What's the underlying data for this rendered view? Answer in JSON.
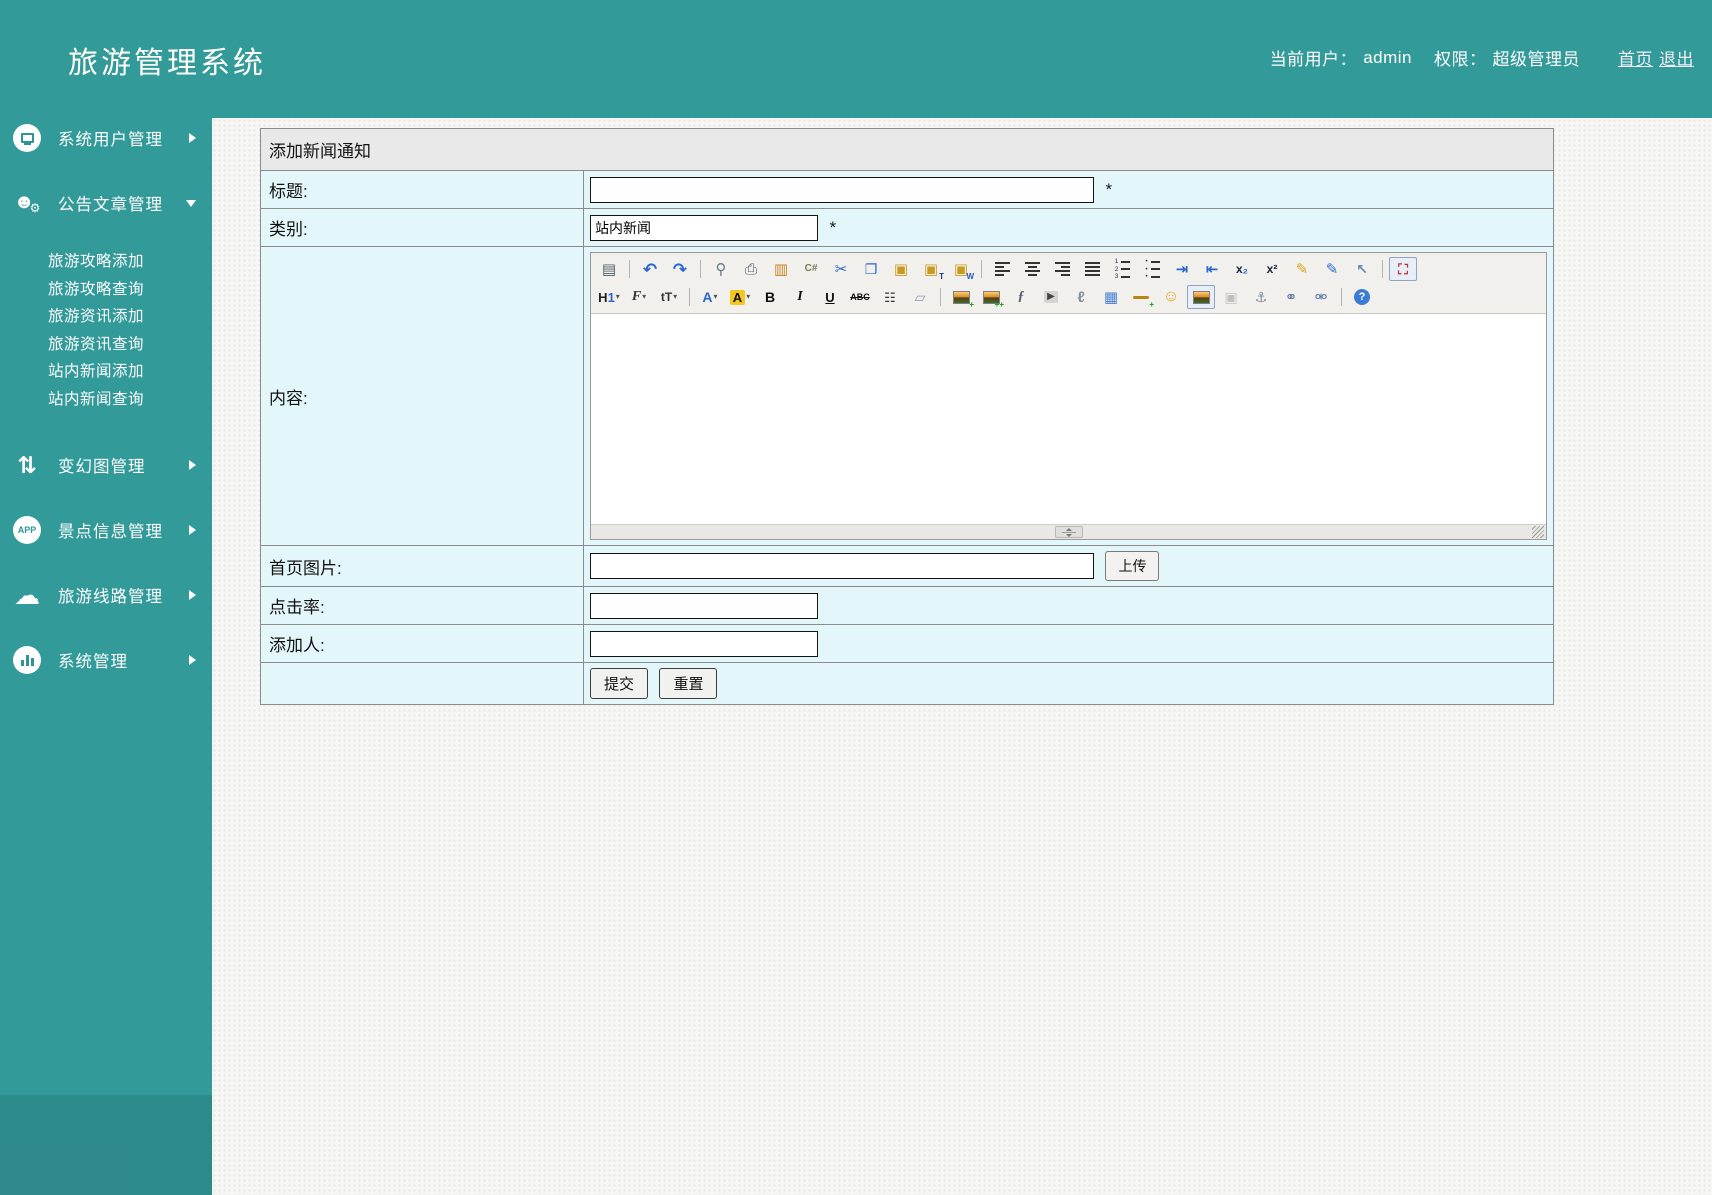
{
  "header": {
    "title": "旅游管理系统",
    "current_user_label": "当前用户：",
    "username": "admin",
    "role_label": "权限：",
    "role": "超级管理员",
    "nav_links": [
      {
        "id": "home",
        "label": "首页"
      },
      {
        "id": "logout",
        "label": "退出"
      }
    ],
    "accent_color": "#339a9a"
  },
  "sidebar": {
    "items": [
      {
        "id": "system-user-management",
        "label": "系统用户管理",
        "icon": "monitor-icon",
        "state": "collapsed"
      },
      {
        "id": "announcement-article-management",
        "label": "公告文章管理",
        "icon": "user-gear-icon",
        "state": "expanded",
        "submenu": [
          {
            "id": "travel-guide-add",
            "label": "旅游攻略添加"
          },
          {
            "id": "travel-guide-query",
            "label": "旅游攻略查询"
          },
          {
            "id": "travel-info-add",
            "label": "旅游资讯添加"
          },
          {
            "id": "travel-info-query",
            "label": "旅游资讯查询"
          },
          {
            "id": "site-news-add",
            "label": "站内新闻添加"
          },
          {
            "id": "site-news-query",
            "label": "站内新闻查询"
          }
        ]
      },
      {
        "id": "banner-image-management",
        "label": "变幻图管理",
        "icon": "swap-arrows-icon",
        "state": "collapsed"
      },
      {
        "id": "scenic-spot-management",
        "label": "景点信息管理",
        "icon": "app-circle-icon",
        "state": "collapsed"
      },
      {
        "id": "travel-route-management",
        "label": "旅游线路管理",
        "icon": "cloud-icon",
        "state": "collapsed"
      },
      {
        "id": "system-management",
        "label": "系统管理",
        "icon": "bar-chart-icon",
        "state": "collapsed"
      }
    ]
  },
  "form": {
    "title": "添加新闻通知",
    "fields": {
      "title": {
        "label": "标题:",
        "value": "",
        "required": "*"
      },
      "category": {
        "label": "类别:",
        "value": "站内新闻",
        "required": "*"
      },
      "content": {
        "label": "内容:",
        "value": ""
      },
      "image": {
        "label": "首页图片:",
        "value": "",
        "upload_button": "上传"
      },
      "clicks": {
        "label": "点击率:",
        "value": ""
      },
      "author": {
        "label": "添加人:",
        "value": ""
      }
    },
    "submit_button": "提交",
    "reset_button": "重置"
  },
  "editor": {
    "toolbar_row1": [
      {
        "name": "view-source-icon",
        "g": "▤",
        "c": "#4a5a66",
        "size": 15
      },
      {
        "sep": true
      },
      {
        "name": "undo-icon",
        "g": "↶",
        "c": "#2a66cc",
        "size": 17,
        "bold": true
      },
      {
        "name": "redo-icon",
        "g": "↷",
        "c": "#2a66cc",
        "size": 17,
        "bold": true
      },
      {
        "sep": true
      },
      {
        "name": "print-preview-icon",
        "g": "⚲",
        "c": "#667788",
        "size": 15,
        "bold": true
      },
      {
        "name": "print-icon",
        "g": "⎙",
        "c": "#556070",
        "size": 15
      },
      {
        "name": "page-properties-icon",
        "g": "▥",
        "c": "#c9821f",
        "size": 15
      },
      {
        "name": "insert-code-icon",
        "g": "C#",
        "c": "#7a7a52",
        "size": 10,
        "bold": true
      },
      {
        "name": "cut-icon",
        "g": "✂",
        "c": "#2a66cc",
        "size": 15
      },
      {
        "name": "copy-icon",
        "g": "❐",
        "c": "#2a66cc",
        "size": 14,
        "bold": true
      },
      {
        "name": "paste-icon",
        "g": "▣",
        "c": "#c99a1e",
        "size": 15
      },
      {
        "name": "paste-as-text-icon",
        "g": "▣",
        "c": "#c99a1e",
        "size": 15,
        "sub": "T",
        "subColor": "#223a8c"
      },
      {
        "name": "paste-from-word-icon",
        "g": "▣",
        "c": "#c99a1e",
        "size": 15,
        "sub": "W",
        "subColor": "#2255cc"
      },
      {
        "sep": true
      },
      {
        "name": "align-left-icon",
        "bars": "left"
      },
      {
        "name": "align-center-icon",
        "bars": "center"
      },
      {
        "name": "align-right-icon",
        "bars": "right"
      },
      {
        "name": "align-justify-icon",
        "bars": "justify"
      },
      {
        "name": "ordered-list-icon",
        "bars": "ol"
      },
      {
        "name": "unordered-list-icon",
        "bars": "ul"
      },
      {
        "name": "indent-icon",
        "g": "⇥",
        "c": "#2a66cc",
        "size": 15,
        "bold": true
      },
      {
        "name": "outdent-icon",
        "g": "⇤",
        "c": "#2a66cc",
        "size": 15,
        "bold": true
      },
      {
        "name": "subscript-icon",
        "t": "x",
        "t2": "₂",
        "c": "#16243f",
        "c2": "#2a66cc",
        "size": 12,
        "bold": true
      },
      {
        "name": "superscript-icon",
        "t": "x",
        "t2": "²",
        "c": "#16243f",
        "c2": "#16243f",
        "size": 12,
        "bold": true
      },
      {
        "name": "clean-code-icon",
        "g": "✎",
        "c": "#dca41c",
        "size": 15,
        "bold": true
      },
      {
        "name": "quick-typesetting-icon",
        "g": "✎",
        "c": "#2f6fd0",
        "size": 15,
        "bold": true
      },
      {
        "name": "select-all-icon",
        "g": "↖",
        "c": "#6688bb",
        "size": 14,
        "bold": true
      },
      {
        "sep": true
      },
      {
        "name": "fullscreen-icon",
        "g": "⛶",
        "c": "#c03030",
        "size": 14,
        "bold": true,
        "pressed": true
      }
    ],
    "toolbar_row2": [
      {
        "name": "paragraph-format-icon",
        "t": "H",
        "t2": "1",
        "c": "#222222",
        "c2": "#2a66cc",
        "size": 13,
        "bold": true,
        "caret": true
      },
      {
        "name": "font-family-icon",
        "t": "F",
        "c": "#333333",
        "size": 14,
        "italicSerif": true,
        "bold": true,
        "caret": true
      },
      {
        "name": "font-size-icon",
        "t": "tT",
        "c": "#333333",
        "size": 12,
        "bold": true,
        "caret": true
      },
      {
        "sep": true
      },
      {
        "name": "font-color-icon",
        "t": "A",
        "c": "#2a66cc",
        "size": 14,
        "bold": true,
        "caret": true
      },
      {
        "name": "highlight-color-icon",
        "t": "A",
        "c": "#111111",
        "size": 13,
        "bold": true,
        "bg": "#f6c51e",
        "caret": true
      },
      {
        "name": "bold-icon",
        "t": "B",
        "c": "#111111",
        "size": 14,
        "bold": true
      },
      {
        "name": "italic-icon",
        "t": "I",
        "c": "#111111",
        "size": 14,
        "bold": true,
        "italicSerif": true
      },
      {
        "name": "underline-icon",
        "t": "U",
        "c": "#111111",
        "size": 13,
        "bold": true,
        "underline": true
      },
      {
        "name": "strikethrough-icon",
        "t": "ABC",
        "c": "#111111",
        "size": 9,
        "bold": true,
        "strike": true
      },
      {
        "name": "line-spacing-icon",
        "g": "☷",
        "c": "#333333",
        "size": 13
      },
      {
        "name": "eraser-icon",
        "g": "▱",
        "c": "#8a97b5",
        "size": 14,
        "bold": true
      },
      {
        "sep": true
      },
      {
        "name": "insert-image-icon",
        "img": true,
        "sub": "+",
        "subColor": "#1a9a1a"
      },
      {
        "name": "batch-upload-image-icon",
        "img": true,
        "sub": "++",
        "subColor": "#1a9a1a"
      },
      {
        "name": "insert-flash-icon",
        "g": "ƒ",
        "c": "#556070",
        "size": 14,
        "bold": true,
        "italicSerif": true
      },
      {
        "name": "insert-media-icon",
        "g": "▶",
        "c": "#444444",
        "size": 10,
        "bg": "#d6d4d0"
      },
      {
        "name": "attachment-icon",
        "g": "ℓ",
        "c": "#8890a0",
        "size": 15,
        "bold": true
      },
      {
        "name": "insert-table-icon",
        "g": "▦",
        "c": "#4a7fd4",
        "size": 15
      },
      {
        "name": "insert-hr-icon",
        "hrline": true,
        "sub": "+",
        "subColor": "#1a9a1a"
      },
      {
        "name": "emoticon-icon",
        "g": "☺",
        "c": "#e8a50f",
        "size": 16,
        "bold": true
      },
      {
        "name": "image-manager-icon",
        "img": true,
        "pressed": true
      },
      {
        "name": "save-icon",
        "g": "▣",
        "c": "#888888",
        "size": 14,
        "disabled": true
      },
      {
        "name": "anchor-icon",
        "g": "⚓",
        "c": "#7d8d9c",
        "size": 14,
        "bold": true
      },
      {
        "name": "link-icon",
        "g": "⚭",
        "c": "#5c7da8",
        "size": 15,
        "bold": true
      },
      {
        "name": "unlink-icon",
        "g": "⚮",
        "c": "#5c7da8",
        "size": 15,
        "bold": true
      },
      {
        "sep": true
      },
      {
        "name": "help-icon",
        "g": "?",
        "c": "#ffffff",
        "size": 11,
        "bold": true,
        "bg": "#3a7bd5",
        "round": true
      }
    ]
  }
}
